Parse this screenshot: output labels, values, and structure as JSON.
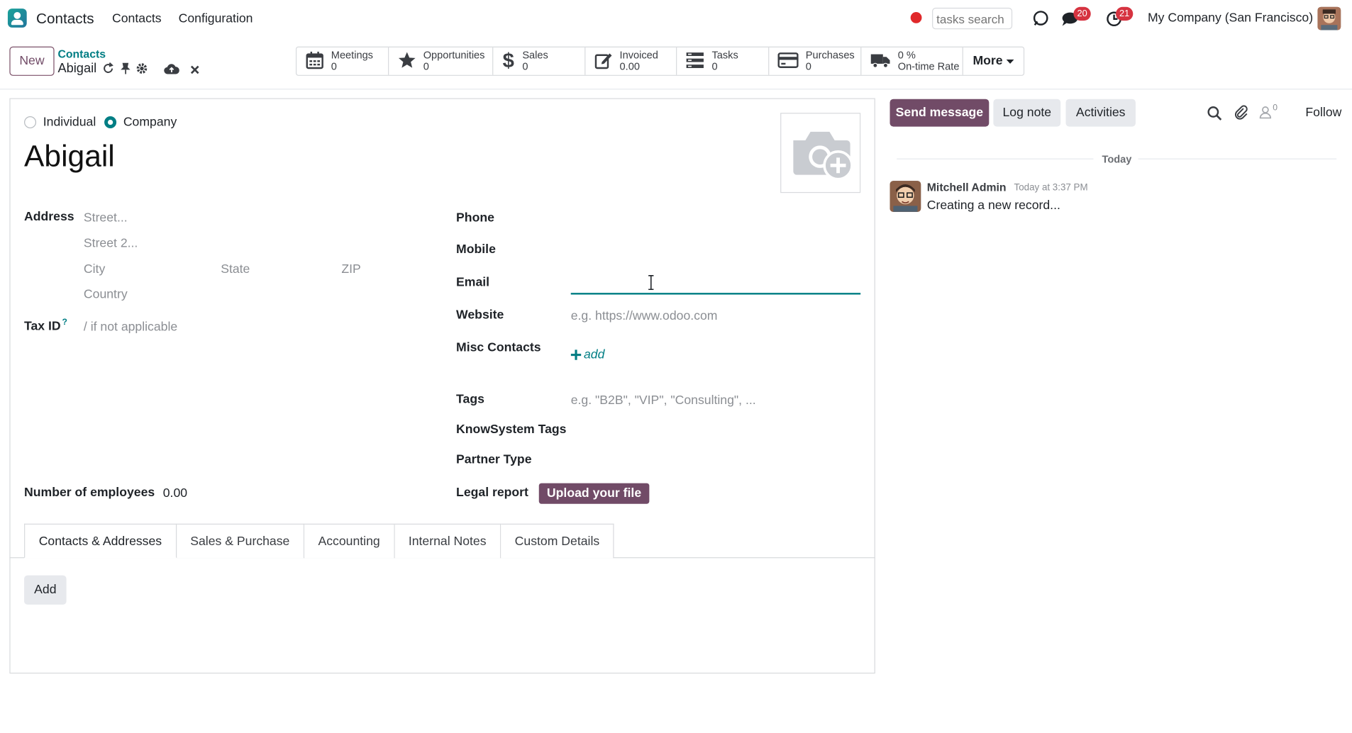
{
  "navbar": {
    "app_name": "Contacts",
    "menus": [
      "Contacts",
      "Configuration"
    ],
    "search_placeholder": "tasks search",
    "messages_badge": "20",
    "activities_badge": "21",
    "company": "My Company (San Francisco)"
  },
  "control_panel": {
    "new_label": "New",
    "breadcrumb_parent": "Contacts",
    "breadcrumb_current": "Abigail",
    "smart_buttons": [
      {
        "label": "Meetings",
        "value": "0",
        "icon": "calendar-icon"
      },
      {
        "label": "Opportunities",
        "value": "0",
        "icon": "star-icon"
      },
      {
        "label": "Sales",
        "value": "0",
        "icon": "dollar-icon"
      },
      {
        "label": "Invoiced",
        "value": "0.00",
        "icon": "edit-icon"
      },
      {
        "label": "Tasks",
        "value": "0",
        "icon": "tasks-icon"
      },
      {
        "label": "Purchases",
        "value": "0",
        "icon": "credit-card-icon"
      },
      {
        "label": "On-time Rate",
        "value": "0 %",
        "icon": "truck-icon"
      }
    ],
    "more_label": "More"
  },
  "form": {
    "type_individual": "Individual",
    "type_company": "Company",
    "selected_type": "Company",
    "name": "Abigail",
    "address_label": "Address",
    "street_ph": "Street...",
    "street2_ph": "Street 2...",
    "city_ph": "City",
    "state_ph": "State",
    "zip_ph": "ZIP",
    "country_ph": "Country",
    "taxid_label": "Tax ID",
    "taxid_help": "?",
    "taxid_ph": "/ if not applicable",
    "phone_label": "Phone",
    "mobile_label": "Mobile",
    "email_label": "Email",
    "website_label": "Website",
    "website_ph": "e.g. https://www.odoo.com",
    "misc_label": "Misc Contacts",
    "misc_add": "add",
    "tags_label": "Tags",
    "tags_ph": "e.g. \"B2B\", \"VIP\", \"Consulting\", ...",
    "knowsystem_label": "KnowSystem Tags",
    "partner_type_label": "Partner Type",
    "employees_label": "Number of employees",
    "employees_value": "0.00",
    "legal_label": "Legal report",
    "upload_label": "Upload your file"
  },
  "tabs": [
    "Contacts & Addresses",
    "Sales & Purchase",
    "Accounting",
    "Internal Notes",
    "Custom Details"
  ],
  "tab_add_label": "Add",
  "chatter": {
    "send_message": "Send message",
    "log_note": "Log note",
    "activities": "Activities",
    "followers_count": "0",
    "follow": "Follow",
    "today": "Today",
    "author": "Mitchell Admin",
    "time": "Today at 3:37 PM",
    "body": "Creating a new record..."
  },
  "colors": {
    "primary": "#714b67",
    "accent": "#017e84",
    "badge": "#d63340"
  }
}
